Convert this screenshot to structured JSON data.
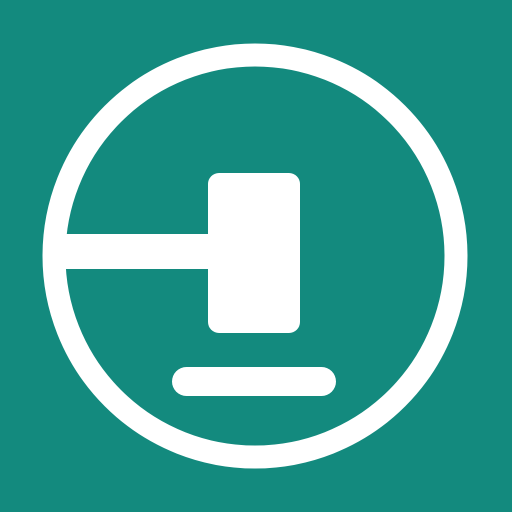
{
  "icon": {
    "name": "gavel-in-circle-icon",
    "background_color": "#138a7e",
    "foreground_color": "#ffffff"
  }
}
